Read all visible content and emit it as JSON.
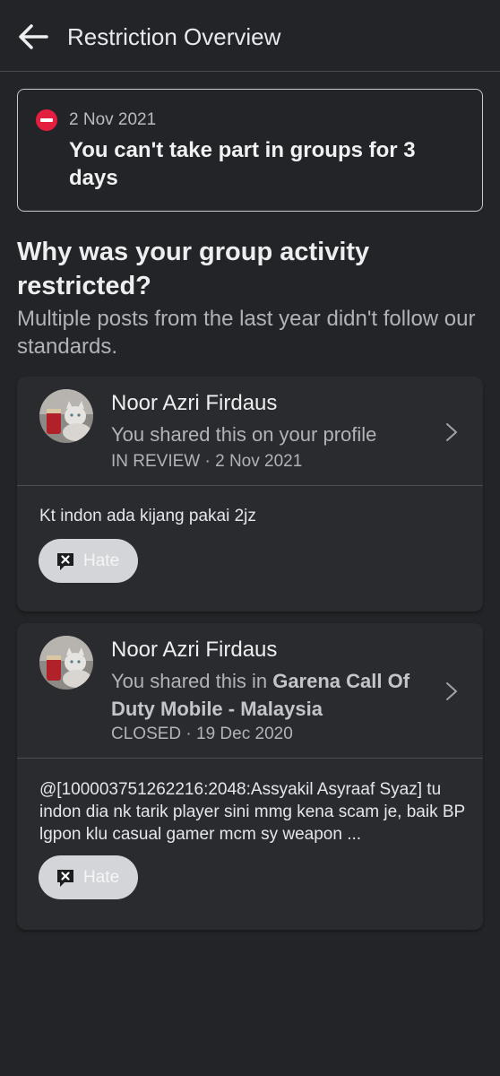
{
  "header": {
    "title": "Restriction Overview"
  },
  "restriction": {
    "date": "2 Nov 2021",
    "message": "You can't take part in groups for 3 days",
    "icon": "no-entry-icon",
    "icon_color": "#e41e3f"
  },
  "explanation": {
    "heading": "Why was your group activity restricted?",
    "description": "Multiple posts from the last year didn't follow our standards."
  },
  "posts": [
    {
      "author": "Noor Azri Firdaus",
      "shared_prefix": "You shared this on your profile",
      "shared_target": "",
      "status": "IN REVIEW · 2 Nov 2021",
      "text": "Kt indon ada kijang pakai 2jz",
      "tag": "Hate"
    },
    {
      "author": "Noor Azri Firdaus",
      "shared_prefix": "You shared this in ",
      "shared_target": "Garena Call Of Duty Mobile - Malaysia",
      "status": "CLOSED · 19 Dec 2020",
      "text": "@[100003751262216:2048:Assyakil Asyraaf Syaz] tu indon dia nk tarik player sini mmg kena scam je, baik BP lgpon klu casual gamer mcm sy weapon ...",
      "tag": "Hate"
    }
  ],
  "colors": {
    "background": "#232427",
    "card": "#2a2b2e",
    "chip": "#d4d5d8"
  }
}
